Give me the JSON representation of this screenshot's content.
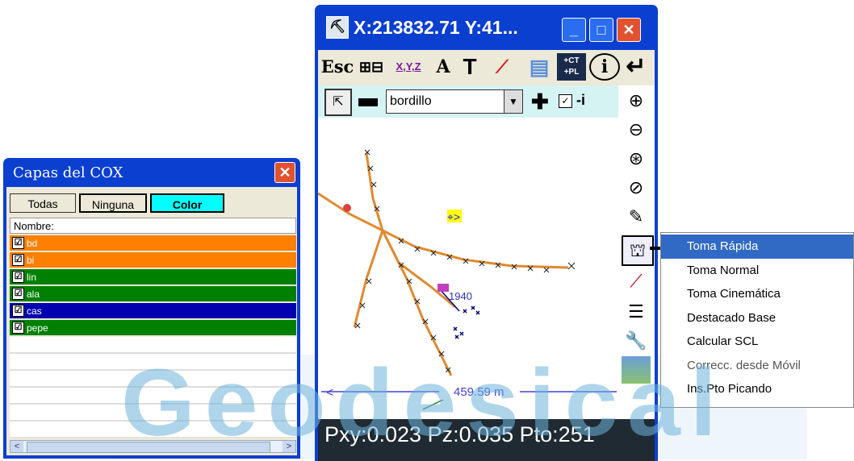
{
  "layers_window": {
    "title": "Capas del COX",
    "close": "✕",
    "buttons": {
      "todas": "Todas",
      "ninguna": "Ninguna",
      "color": "Color"
    },
    "column_header": "Nombre:",
    "layers": [
      {
        "name": "bd",
        "checked": "☑",
        "color": "#ff8000"
      },
      {
        "name": "bi",
        "checked": "☑",
        "color": "#ff8000"
      },
      {
        "name": "lin",
        "checked": "☑",
        "color": "#008000"
      },
      {
        "name": "ala",
        "checked": "☑",
        "color": "#008000"
      },
      {
        "name": "cas",
        "checked": "☑",
        "color": "#0000b0"
      },
      {
        "name": "pepe",
        "checked": "☑",
        "color": "#008000"
      }
    ]
  },
  "main_window": {
    "title": "X:213832.71 Y:41...",
    "controls": {
      "minimize": "_",
      "maximize": "□",
      "close": "✕"
    },
    "toolbar": {
      "esc": "Esc",
      "xyz": "X,Y,Z",
      "text_tool": "A",
      "pole": "T",
      "ct_pl": "+CT +PL",
      "info": "i",
      "enter": "↵"
    },
    "code_select": "bordillo",
    "plus": "✚",
    "invert": "-i",
    "checkbox": "✓",
    "map": {
      "point_label": "1940",
      "scale_label": "459.59 m",
      "target_symbol": "⌖>"
    },
    "status": "Pxy:0.023 Pz:0.035 Pto:251"
  },
  "context_menu": {
    "items": [
      "Toma Rápida",
      "Toma Normal",
      "Toma Cinemática",
      "Destacado Base",
      "Calcular SCL",
      "Correcc. desde Móvil",
      "Ins.Pto Picando"
    ],
    "selected": "Toma Rápida"
  },
  "watermark": "Geodesical",
  "colors": {
    "titlebar": "#0a3fd0",
    "accent_cyan": "#00ffff",
    "menu_highlight": "#316ac5",
    "orange": "#ff8000",
    "green": "#008000"
  }
}
